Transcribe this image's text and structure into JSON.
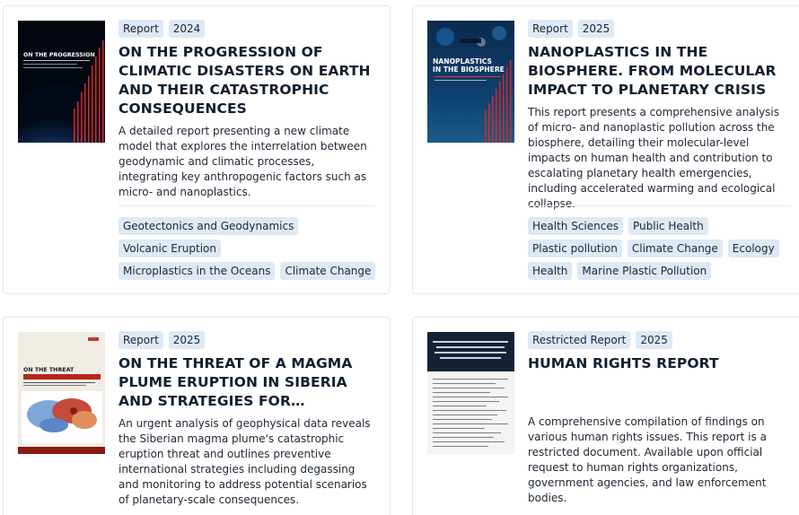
{
  "cards": [
    {
      "type": "Report",
      "year": "2024",
      "title": "ON THE PROGRESSION OF CLIMATIC DISASTERS ON EARTH AND THEIR CATASTROPHIC CONSEQUENCES",
      "description": "A detailed report presenting a new climate model that explores the interrelation between geodynamic and climatic processes, integrating key anthropogenic factors such as micro- and nanoplastics.",
      "cover_title": "ON THE PROGRESSION",
      "tags": [
        "Geotectonics and Geodynamics",
        "Volcanic Eruption",
        "Microplastics in the Oceans",
        "Climate Change"
      ]
    },
    {
      "type": "Report",
      "year": "2025",
      "title": "NANOPLASTICS IN THE BIOSPHERE. FROM MOLECULAR IMPACT TO PLANETARY CRISIS",
      "description": "This report presents a comprehensive analysis of micro- and nanoplastic pollution across the biosphere, detailing their molecular-level impacts on human health and contribution to escalating planetary health emergencies, including accelerated warming and ecological collapse.",
      "cover_title_line1": "NANOPLASTICS",
      "cover_title_line2": "IN THE BIOSPHERE",
      "tags": [
        "Health Sciences",
        "Public Health",
        "Plastic pollution",
        "Climate Change",
        "Ecology",
        "Health",
        "Marine Plastic Pollution"
      ]
    },
    {
      "type": "Report",
      "year": "2025",
      "title": "ON THE THREAT OF A MAGMA PLUME ERUPTION IN SIBERIA AND STRATEGIES FOR ADDRESSING THE CONSEQUENCES",
      "description": "An urgent analysis of geophysical data reveals the Siberian magma plume's catastrophic eruption threat and outlines preventive international strategies including degassing and monitoring to address potential scenarios of planetary-scale consequences.",
      "cover_title": "ON THE THREAT"
    },
    {
      "type": "Restricted Report",
      "year": "2025",
      "title": "HUMAN RIGHTS REPORT",
      "description": "A comprehensive compilation of findings on various human rights issues. This report is a restricted document. Available upon official request to human rights organizations, government agencies, and law enforcement bodies."
    }
  ],
  "colors": {
    "badge_bg": "#dde9f5",
    "title": "#102030",
    "border": "#e3e7ec"
  }
}
